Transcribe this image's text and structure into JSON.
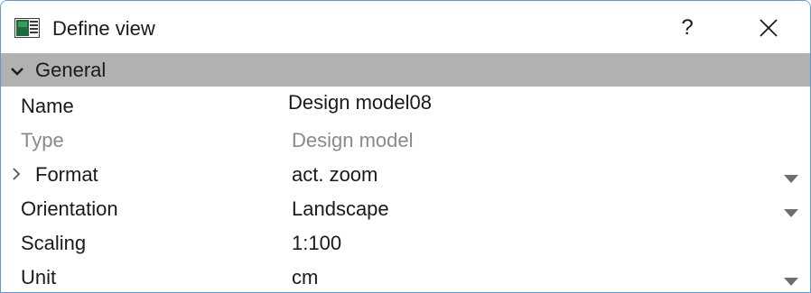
{
  "window": {
    "title": "Define view",
    "help_label": "?",
    "icons": {
      "app": "view-icon",
      "close": "close-icon"
    }
  },
  "group": {
    "label": "General",
    "expanded": true
  },
  "properties": {
    "name": {
      "label": "Name",
      "value": "Design model08"
    },
    "type": {
      "label": "Type",
      "value": "Design model",
      "disabled": true
    },
    "format": {
      "label": "Format",
      "value": "act. zoom",
      "expandable": true,
      "dropdown": true
    },
    "orientation": {
      "label": "Orientation",
      "value": "Landscape",
      "dropdown": true
    },
    "scaling": {
      "label": "Scaling",
      "value": "1:100"
    },
    "unit": {
      "label": "Unit",
      "value": "cm",
      "dropdown": true
    }
  },
  "colors": {
    "group_header_bg": "#b1b1b1",
    "disabled_text": "#8a8a8a",
    "window_border": "#5b9bd5"
  }
}
